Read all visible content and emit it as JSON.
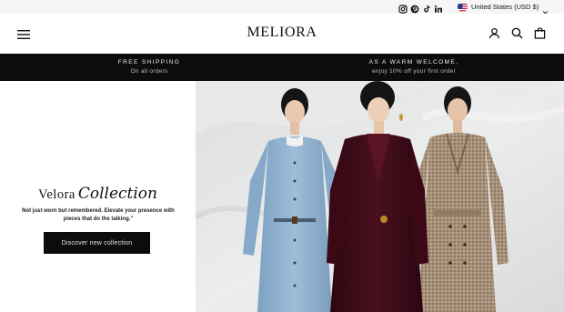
{
  "topbar": {
    "social_icons": [
      "instagram-icon",
      "pinterest-icon",
      "tiktok-icon",
      "linkedin-icon"
    ],
    "currency": {
      "label": "United States (USD $)",
      "flag": "us-flag-icon"
    }
  },
  "header": {
    "logo": "MELIORA",
    "icons": [
      "menu-icon",
      "account-icon",
      "search-icon",
      "cart-icon"
    ]
  },
  "announcements": [
    {
      "title": "FREE SHIPPING",
      "subtitle": "On all orders"
    },
    {
      "title": "AS A WARM WELCOME,",
      "subtitle": "enjoy 10% off your first order"
    }
  ],
  "hero": {
    "title_word": "Velora",
    "title_script": "Collection",
    "tagline": "Not just worn but remembered. Elevate your presence with pieces that do the talking.\"",
    "cta_label": "Discover new collection"
  },
  "colors": {
    "announcement_bg": "#0c0c0c",
    "blue_dress": "#8fb1cf",
    "burgundy_dress": "#3e0c18",
    "tweed_coat": "#a38e78",
    "backdrop": "#e3e4e5"
  }
}
